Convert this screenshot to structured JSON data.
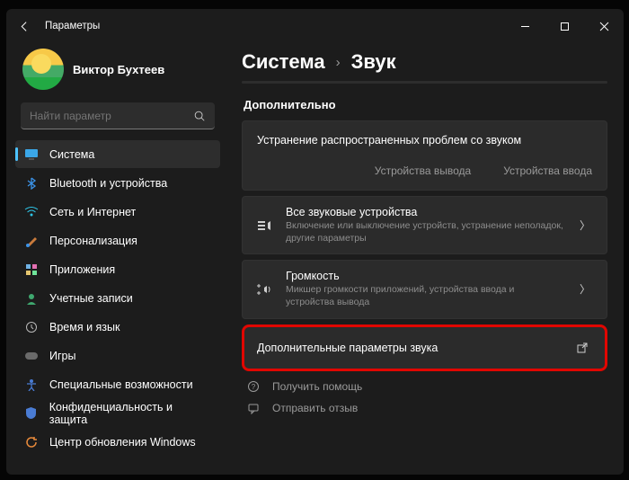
{
  "titlebar": {
    "title": "Параметры"
  },
  "user": {
    "name": "Виктор Бухтеев"
  },
  "search": {
    "placeholder": "Найти параметр"
  },
  "sidebar": {
    "items": [
      {
        "label": "Система"
      },
      {
        "label": "Bluetooth и устройства"
      },
      {
        "label": "Сеть и Интернет"
      },
      {
        "label": "Персонализация"
      },
      {
        "label": "Приложения"
      },
      {
        "label": "Учетные записи"
      },
      {
        "label": "Время и язык"
      },
      {
        "label": "Игры"
      },
      {
        "label": "Специальные возможности"
      },
      {
        "label": "Конфиденциальность и защита"
      },
      {
        "label": "Центр обновления Windows"
      }
    ]
  },
  "breadcrumb": {
    "parent": "Система",
    "current": "Звук"
  },
  "section_title": "Дополнительно",
  "troubleshoot": {
    "title": "Устранение распространенных проблем со звуком",
    "output": "Устройства вывода",
    "input": "Устройства ввода"
  },
  "cards": {
    "all_devices": {
      "title": "Все звуковые устройства",
      "sub": "Включение или выключение устройств, устранение неполадок, другие параметры"
    },
    "volume": {
      "title": "Громкость",
      "sub": "Микшер громкости приложений, устройства ввода и устройства вывода"
    },
    "more": {
      "title": "Дополнительные параметры звука"
    }
  },
  "links": {
    "help": "Получить помощь",
    "feedback": "Отправить отзыв"
  }
}
